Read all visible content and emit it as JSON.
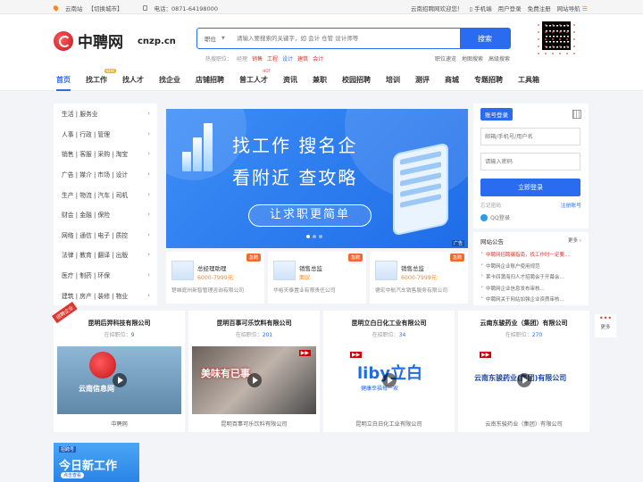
{
  "topbar": {
    "site": "云南站",
    "switch": "【切换城市】",
    "phone": "电话：0871-64198000",
    "welcome": "云南招聘网欢迎您！",
    "mobile": "手机端",
    "login": "用户登录",
    "register": "免费注册",
    "sitenav": "网站导航"
  },
  "logo": {
    "name": "中聘网",
    "domain": "cnzp.cn"
  },
  "search": {
    "select": "职位",
    "placeholder": "请输入要搜索的关键字，如 会计 仓管 设计师等",
    "button": "搜索"
  },
  "hot": {
    "label": "热搜职位：",
    "items": [
      "经理",
      "销售",
      "工程",
      "设计",
      "建筑",
      "会计"
    ]
  },
  "quick": [
    "职位速览",
    "地图搜索",
    "高级搜索"
  ],
  "nav": {
    "items": [
      "首页",
      "找工作",
      "找人才",
      "找企业",
      "店铺招聘",
      "普工人才",
      "资讯",
      "兼职",
      "校园招聘",
      "培训",
      "测评",
      "商城",
      "专题招聘",
      "工具箱"
    ],
    "badge_new": "NEW",
    "badge_hot": "HOT"
  },
  "categories": [
    "生活 | 服务业",
    "人事 | 行政 | 管理",
    "销售 | 客服 | 采购 | 淘宝",
    "广告 | 媒介 | 市场 | 设计",
    "生产 | 物流 | 汽车 | 司机",
    "财会 | 金融 | 保险",
    "网络 | 通信 | 电子 | 质控",
    "法律 | 教育 | 翻译 | 出版",
    "医疗 | 制药 | 环保",
    "建筑 | 房产 | 装修 | 物业"
  ],
  "banner": {
    "line1": "找工作   搜名企",
    "line2": "看附近   查攻略",
    "pill": "让求职更简单",
    "ad": "广告"
  },
  "jobs": [
    {
      "tag": "急聘",
      "title": "总经理助理",
      "salary": "6000-7999元",
      "company": "楚雄庭州新智管理咨询有限公司"
    },
    {
      "tag": "急聘",
      "title": "销售总监",
      "salary": "面议",
      "company": "华裕天泰置业有限责任公司"
    },
    {
      "tag": "急聘",
      "title": "销售总监",
      "salary": "6000-7999元",
      "company": "德宏中航汽车销售服务有限公司"
    }
  ],
  "login": {
    "tab": "账号登录",
    "user_placeholder": "邮箱/手机号/用户名",
    "pass_placeholder": "请输入密码",
    "submit": "立即登录",
    "forgot": "忘记密码",
    "register": "注册账号",
    "qq": "QQ登录"
  },
  "notice": {
    "title": "网站公告",
    "more": "更多",
    "items": [
      "中聘网招聘骗指南，找工作时一定要...",
      "中聘网企业账户使用规范",
      "莱卡四蒲海归人才招聘会于开幕会...",
      "中聘网企业信息发布审核...",
      "中聘网关于网站加强企业资质审核..."
    ]
  },
  "float": {
    "label": "更多"
  },
  "companies": [
    {
      "name": "昆明后羿科技有限公司",
      "count_label": "在招职位：",
      "count": "9",
      "caption": "中聘网",
      "video_text": "云南信息网",
      "ribbon": "招聘企业"
    },
    {
      "name": "昆明百事可乐饮料有限公司",
      "count_label": "在招职位：",
      "count": "201",
      "caption": "昆明百事可乐饮料有限公司",
      "video_text": "美味有已事"
    },
    {
      "name": "昆明立白日化工业有限公司",
      "count_label": "在招职位：",
      "count": "34",
      "caption": "昆明立白日化工业有限公司",
      "video_text": "liby立白",
      "slogan": "健康幸福每一家"
    },
    {
      "name": "云南东骏药业（集团）有限公司",
      "count_label": "在招职位：",
      "count": "270",
      "caption": "云南东骏药业（集团）有限公司",
      "video_text": "云南东骏药业(集团)有限公司"
    }
  ],
  "promo": {
    "small": "招聘号",
    "big": "今日新工作",
    "sub": "点击查看"
  },
  "colors": {
    "accent": "#2a6cf0",
    "hot": "#e0352b",
    "salary": "#f5862b"
  }
}
